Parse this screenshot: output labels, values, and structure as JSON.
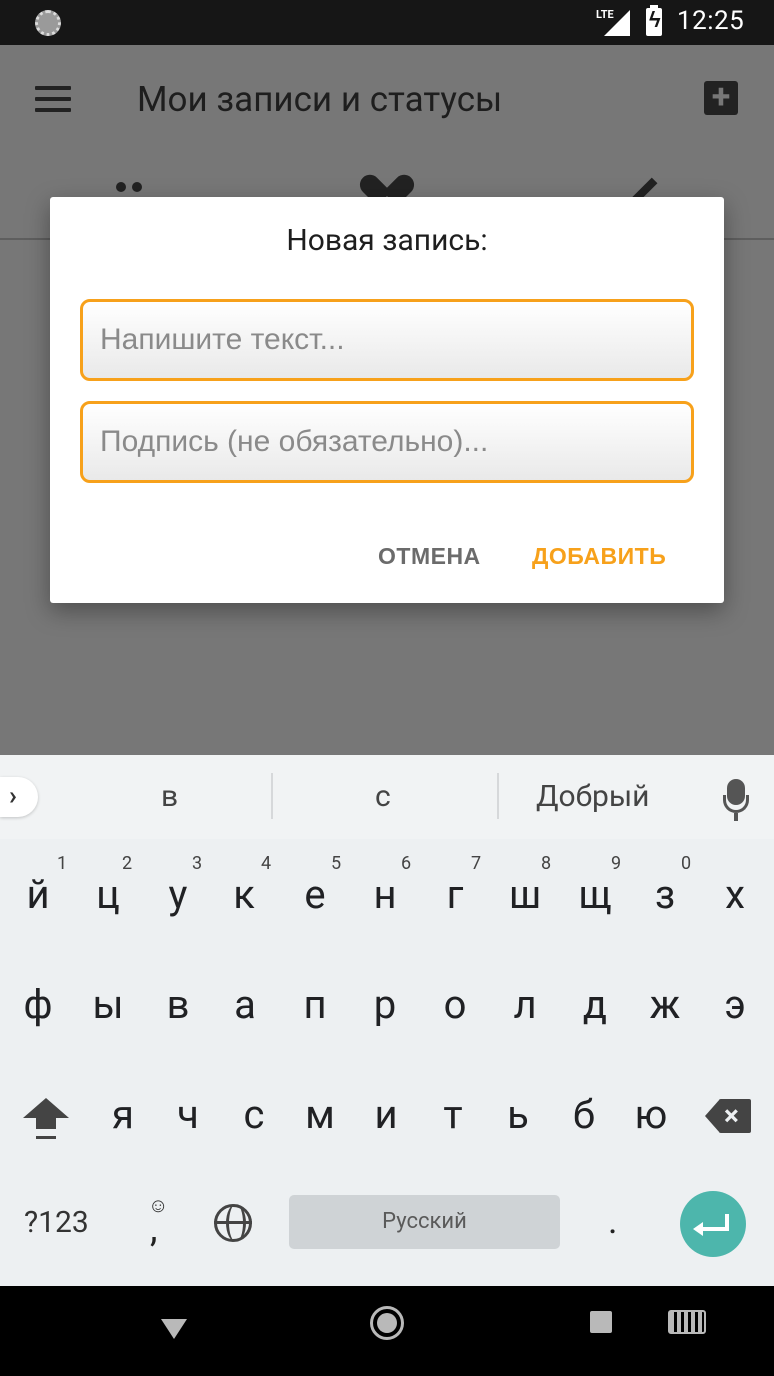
{
  "status_bar": {
    "network": "LTE",
    "time": "12:25"
  },
  "app_bar": {
    "title": "Мои записи и статусы",
    "tabs": [
      "people-icon",
      "heart-icon",
      "edit-icon"
    ]
  },
  "dialog": {
    "title": "Новая запись:",
    "text_placeholder": "Напишите текст...",
    "text_value": "",
    "signature_placeholder": "Подпись (не обязательно)...",
    "signature_value": "",
    "cancel_label": "ОТМЕНА",
    "add_label": "ДОБАВИТЬ",
    "accent_color": "#f7a11b"
  },
  "keyboard": {
    "suggestions": [
      "в",
      "с",
      "Добрый"
    ],
    "row1": [
      "й",
      "ц",
      "у",
      "к",
      "е",
      "н",
      "г",
      "ш",
      "щ",
      "з",
      "х"
    ],
    "row1_hints": [
      "1",
      "2",
      "3",
      "4",
      "5",
      "6",
      "7",
      "8",
      "9",
      "0"
    ],
    "row2": [
      "ф",
      "ы",
      "в",
      "а",
      "п",
      "р",
      "о",
      "л",
      "д",
      "ж",
      "э"
    ],
    "row3": [
      "я",
      "ч",
      "с",
      "м",
      "и",
      "т",
      "ь",
      "б",
      "ю"
    ],
    "symbols_label": "?123",
    "emoji_glyph": "☺",
    "comma": ",",
    "space_label": "Русский",
    "period": ".",
    "enter_color": "#4db6ac"
  }
}
